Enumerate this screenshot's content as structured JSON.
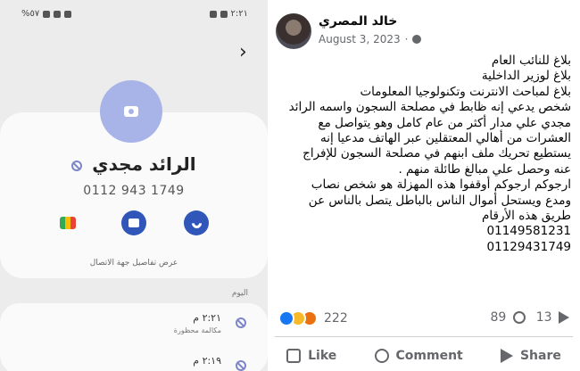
{
  "phone": {
    "status_bar": {
      "time": "٢:٢١",
      "battery": "%٥٧"
    },
    "contact": {
      "name": "الرائد مجدي",
      "number": "0112 943 1749",
      "details_link": "عرض تفاصيل جهة الاتصال"
    },
    "call_log": {
      "section_label": "اليوم",
      "entries": [
        {
          "time": "٢:٢١ م",
          "status": "مكالمة محظورة"
        },
        {
          "time": "٢:١٩ م",
          "status": ""
        }
      ]
    },
    "icons": [
      "chevron-right-icon",
      "camera-icon",
      "blocked-icon",
      "google-meet-icon",
      "message-icon",
      "phone-icon"
    ]
  },
  "post": {
    "author": "خالد المصري",
    "date": "August 3, 2023",
    "lines": [
      "بلاغ للنائب العام",
      "بلاغ لوزير الداخلية",
      "بلاغ لمباحث الانترنت وتكنولوجيا المعلومات",
      "شخص يدعي إنه ظابط في مصلحة السجون واسمه الرائد",
      "مجدي علي مدار أكثر من عام كامل وهو يتواصل مع",
      "العشرات من أهالي المعتقلين عبر الهاتف مدعيا إنه",
      "يستطيع تحريك ملف ابنهم في مصلحة السجون للإفراج",
      "عنه وحصل علي مبالغ طائلة منهم .",
      "ارجوكم ارجوكم أوقفوا هذه المهزلة هو شخص نصاب",
      "ومدع ويستحل أموال الناس بالباطل يتصل بالناس عن",
      "طريق هذه الأرقام",
      "01149581231",
      "01129431749"
    ],
    "reaction_count": "222",
    "comment_count": "89",
    "share_count": "13",
    "actions": {
      "like": "Like",
      "comment": "Comment",
      "share": "Share"
    },
    "colors": {
      "like_blue": "#1877f2",
      "text": "#050505",
      "muted": "#65676b"
    }
  }
}
